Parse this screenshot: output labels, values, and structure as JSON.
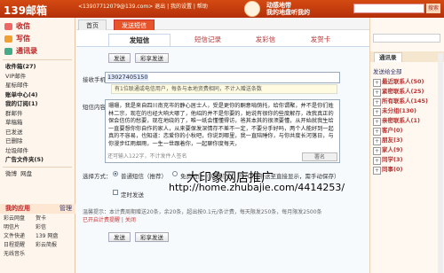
{
  "topbar": {
    "logo": "139邮箱",
    "user": "<13907712079@139.com>",
    "links": "退出 | 我的设置 | 帮助",
    "slogan_1": "动感地带",
    "slogan_2": "我的地盘听我的",
    "search_btn": "搜索"
  },
  "sidebar": {
    "inbox": "收信",
    "compose": "写信",
    "contacts": "通讯录",
    "items": [
      "收件箱(27)",
      "VIP邮件",
      "星标邮件",
      "账单中心(4)",
      "我的订阅(1)",
      "群邮件",
      "草稿箱",
      "已发送",
      "已删除",
      "垃圾邮件",
      "广告文件夹(5)"
    ],
    "extra": [
      "微博",
      "网盘"
    ],
    "apps_title": "我的应用",
    "manage": "管理",
    "apps": [
      "彩云网盘",
      "贺卡",
      "明信片",
      "彩信",
      "文件快递",
      "139 网盘",
      "日程提醒",
      "彩云简报",
      "无线音乐"
    ]
  },
  "tabs": {
    "home": "首页",
    "active": "发送短信"
  },
  "subtabs": [
    "发短信",
    "短信记录",
    "发彩信",
    "发贺卡"
  ],
  "compose": {
    "send": "发送",
    "color_send": "彩享发送",
    "to_label": "接收手机：",
    "to_value": "13027405150",
    "hint": "有1位联通或电信用户，每条与本地资费相同，不计入赠送条数",
    "body_label": "短信内容：",
    "body": "珊珊，我是来自四川南充市的静心居士人，受是更你的酮意啃荫托，给你谓聚，并不是你们姓林二宗，现在的也经大响大哪了，他绍的并不是你要的，她说有很你的些度解存，改我真正的保会信仿的愁要，现在地绕的了，唯一纸会懂懂得访，爸其本其的很须要懂，从开始就我生给一直要想你你自作的家人，从来要保发深情存不差不一定，不要分手好吗，两个人能好到一起真的不容易，也知道：恋爱你的小秋吧，你说到哪里，我一直陪睡你，与你共度长河落日，与你漫步红雨烟雨，一生一世跟着你，一起聊你度每天，",
    "count": "还可输入122字，不计发件人签名",
    "sig": "署名",
    "send_label": "选择方式：",
    "normal": "普通短信（推荐）",
    "free": "免费短信（无需点击，按70字/条送至直接显示，需手动保存）",
    "timed": "定时发送",
    "note": "温馨提示：本计费周期赠送20条，余20条，超出按0.1元/条计费，每天限发250条，每月限发2500条",
    "note_link": "已开启计费提醒",
    "note_close": "关闭"
  },
  "watermark": {
    "line1": "大印象网店推广",
    "line2": "http://home.zhubajie.com/4414253/"
  },
  "right": {
    "tab_1": "通讯录",
    "tab_2": "",
    "btn_send": "发送给全部",
    "items": [
      "最近联系人(50)",
      "紧密联系人(25)",
      "所有联系人(145)",
      "未分组(130)",
      "亲密联系人(1)",
      "客户(0)",
      "朋友(3)",
      "家人(9)",
      "同学(3)",
      "同事(0)"
    ]
  }
}
